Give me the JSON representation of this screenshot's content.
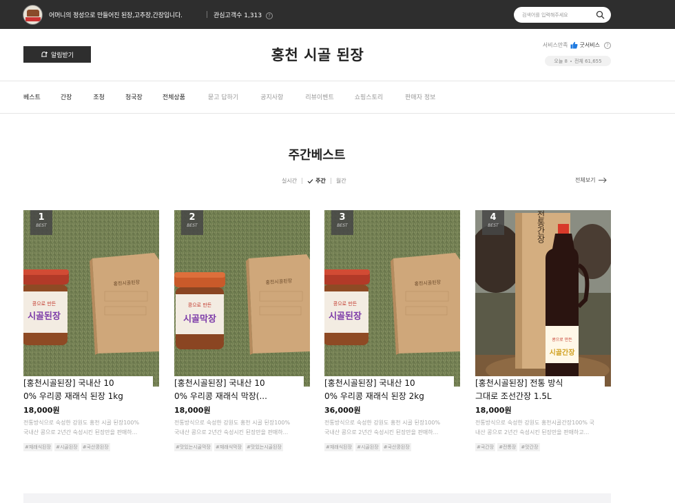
{
  "topbar": {
    "slogan": "어머니의 정성으로 만들어진 된장,고추장,간장입니다.",
    "fans_label": "관심고객수",
    "fans_count": "1,313",
    "search_placeholder": "검색어를 입력해주세요"
  },
  "header": {
    "alarm_label": "알림받기",
    "store_name": "홍천 시골 된장",
    "service_label": "서비스만족",
    "service_value": "굿서비스",
    "visits_today": "오늘 8",
    "visits_total": "전체 61,655"
  },
  "nav": [
    {
      "label": "베스트",
      "style": "dark"
    },
    {
      "label": "간장",
      "style": "dark"
    },
    {
      "label": "조청",
      "style": "dark"
    },
    {
      "label": "청국장",
      "style": "dark"
    },
    {
      "label": "전체상품",
      "style": "dark"
    },
    {
      "label": "묻고 답하기",
      "style": "light"
    },
    {
      "label": "공지사항",
      "style": "light"
    },
    {
      "label": "리뷰이벤트",
      "style": "light"
    },
    {
      "label": "쇼핑스토리",
      "style": "light"
    },
    {
      "label": "판매자 정보",
      "style": "light"
    }
  ],
  "section": {
    "title": "주간베스트",
    "tabs": [
      "실시간",
      "주간",
      "월간"
    ],
    "active_tab": "주간",
    "view_all": "전체보기"
  },
  "products": [
    {
      "rank": "1",
      "badge": "BEST",
      "name_line1": "[홍천시골된장] 국내산 10",
      "name_line2": "0% 우리콩 재래식 된장 1kg",
      "price": "18,000원",
      "desc_line1": "전통방식으로 숙성한 강원도 홍천 시골 된장100%",
      "desc_line2": "국내산 콩으로 2년간 숙성시킨 된장만을 판매하...",
      "tags": [
        "#재래식된장",
        "#시골된장",
        "#국산콩된장"
      ],
      "jar_label": "시골된장",
      "lid_color": "#b23a28"
    },
    {
      "rank": "2",
      "badge": "BEST",
      "name_line1": "[홍천시골된장] 국내산 10",
      "name_line2": "0% 우리콩 재래식 막장(...",
      "price": "18,000원",
      "desc_line1": "전통방식으로 숙성한 강원도 홍천 시골 된장100%",
      "desc_line2": "국내산 콩으로 2년간 숙성시킨 된장만을 판매하...",
      "tags": [
        "#맛있는시골막장",
        "#재래식막장",
        "#맛있는시골된장"
      ],
      "jar_label": "시골막장",
      "lid_color": "#c95a2a"
    },
    {
      "rank": "3",
      "badge": "BEST",
      "name_line1": "[홍천시골된장] 국내산 10",
      "name_line2": "0% 우리콩 재래식 된장 2kg",
      "price": "36,000원",
      "desc_line1": "전통방식으로 숙성한 강원도 홍천 시골 된장100%",
      "desc_line2": "국내산 콩으로 2년간 숙성시킨 된장만을 판매하...",
      "tags": [
        "#재래식된장",
        "#시골된장",
        "#국산콩된장"
      ],
      "jar_label": "시골된장",
      "lid_color": "#b23a28"
    },
    {
      "rank": "4",
      "badge": "BEST",
      "name_line1": "[홍천시골된장] 전통 방식",
      "name_line2": "그대로 조선간장 1.5L",
      "price": "18,000원",
      "desc_line1": "전통방식으로 숙성한 강원도 홍천시골간장100% 국",
      "desc_line2": "내산 콩으로 2년간 숙성시킨 된장만을 판매하고...",
      "tags": [
        "#국간장",
        "#전통장",
        "#맛간장"
      ],
      "box_label": "전통간장",
      "bottle_label": "시골간장"
    }
  ],
  "colors": {
    "topbar_bg": "#2e2e2e",
    "grass": "#6d7a4e"
  }
}
